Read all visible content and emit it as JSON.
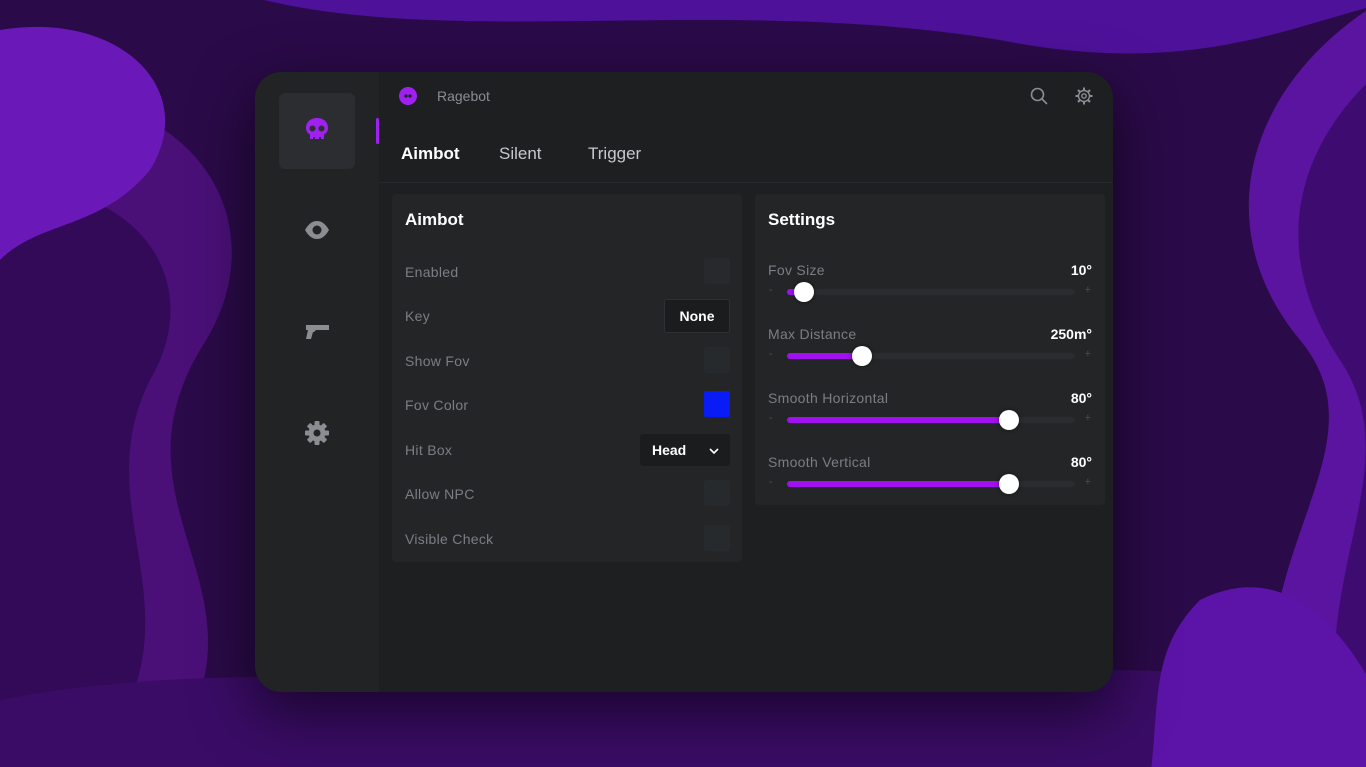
{
  "colors": {
    "accent": "#a020f0",
    "window_bg": "#1d1f21",
    "sidebar_bg": "#212325",
    "panel_bg": "#232527",
    "fov_color": "#0a1cf5"
  },
  "sidebar": {
    "items": [
      {
        "icon": "skull-icon",
        "active": true
      },
      {
        "icon": "eye-icon",
        "active": false
      },
      {
        "icon": "gun-icon",
        "active": false
      },
      {
        "icon": "gear-icon",
        "active": false
      }
    ]
  },
  "header": {
    "title": "Ragebot",
    "icons": [
      "search-icon",
      "settings-gear-icon"
    ]
  },
  "tabs": [
    {
      "label": "Aimbot",
      "active": true
    },
    {
      "label": "Silent",
      "active": false
    },
    {
      "label": "Trigger",
      "active": false
    }
  ],
  "aimbot_panel": {
    "title": "Aimbot",
    "rows": {
      "enabled": {
        "label": "Enabled",
        "checked": false
      },
      "key": {
        "label": "Key",
        "value": "None"
      },
      "show_fov": {
        "label": "Show Fov",
        "checked": false
      },
      "fov_color": {
        "label": "Fov Color",
        "color": "#0a1cf5"
      },
      "hit_box": {
        "label": "Hit Box",
        "value": "Head"
      },
      "allow_npc": {
        "label": "Allow NPC",
        "checked": false
      },
      "visible_check": {
        "label": "Visible Check",
        "checked": false
      }
    }
  },
  "settings_panel": {
    "title": "Settings",
    "sliders": [
      {
        "label": "Fov Size",
        "value": "10°",
        "fraction": 0.06
      },
      {
        "label": "Max Distance",
        "value": "250m°",
        "fraction": 0.26
      },
      {
        "label": "Smooth Horizontal",
        "value": "80°",
        "fraction": 0.77
      },
      {
        "label": "Smooth Vertical",
        "value": "80°",
        "fraction": 0.77
      }
    ],
    "minus_symbol": "-",
    "plus_symbol": "+"
  }
}
